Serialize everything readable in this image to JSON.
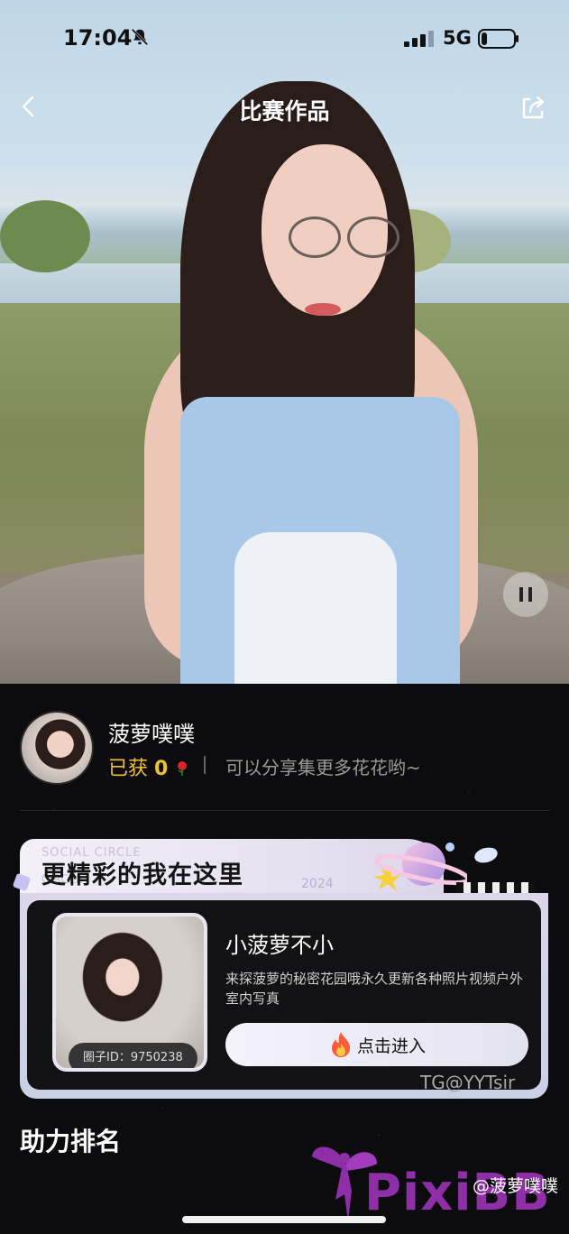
{
  "status_bar": {
    "time": "17:04",
    "network": "5G"
  },
  "nav": {
    "title": "比赛作品"
  },
  "profile": {
    "username": "菠萝噗噗",
    "earned_label": "已获",
    "earned_count": "0",
    "share_hint": "可以分享集更多花花哟~"
  },
  "promo": {
    "header_title": "更精彩的我在这里",
    "header_ghost_text": "SOCIAL CIRCLE",
    "header_ghost_text2": "CIRCLE",
    "header_year": "2024",
    "circle_id": "圈子ID：9750238",
    "circle_name": "小菠萝不小",
    "circle_desc": "来探菠萝的秘密花园哦永久更新各种照片视频户外 室内写真",
    "enter_label": "点击进入"
  },
  "ranking": {
    "title": "助力排名"
  },
  "watermarks": {
    "tg": "TG@YYTsir",
    "site": "PixiBB",
    "user": "@菠萝噗噗"
  },
  "colors": {
    "accent_gold": "#f1c02f",
    "background": "#0c0c0e",
    "watermark_purple": "#8e2fa8"
  }
}
